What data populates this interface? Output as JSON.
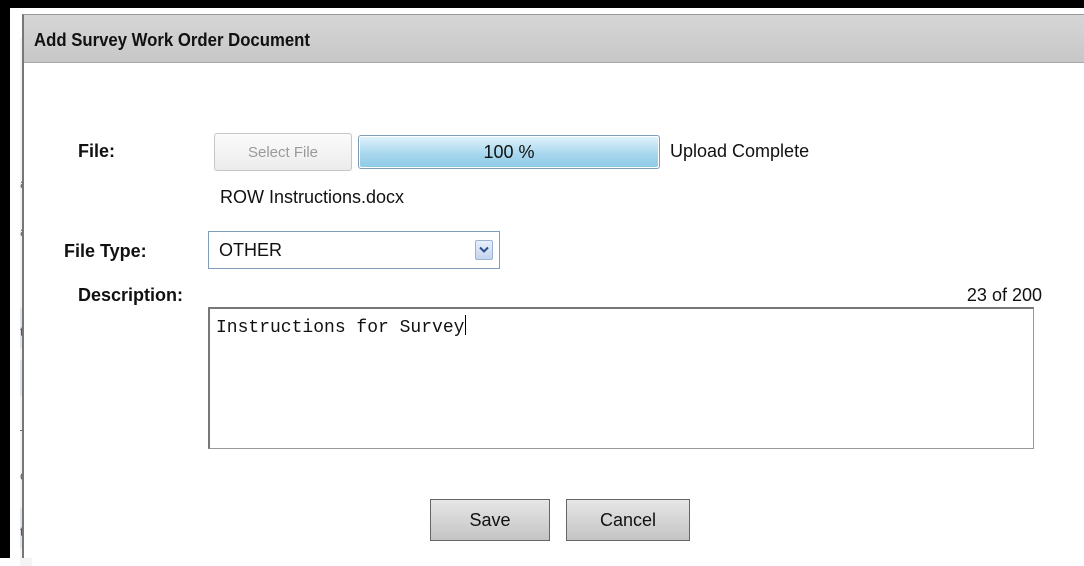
{
  "dialog": {
    "title": "Add Survey Work Order Document"
  },
  "file": {
    "label": "File:",
    "select_button": "Select File",
    "progress_text": "100 %",
    "progress_fraction": 1.0,
    "status": "Upload Complete",
    "file_name": "ROW Instructions.docx"
  },
  "file_type": {
    "label": "File Type:",
    "selected": "OTHER"
  },
  "description": {
    "label": "Description:",
    "counter": "23 of 200",
    "value": "Instructions for Survey"
  },
  "actions": {
    "save": "Save",
    "cancel": "Cancel"
  },
  "background_fragments": [
    "a",
    "a",
    "t",
    "c",
    "t"
  ],
  "colors": {
    "title_bar": "#cfcfcf",
    "progress_fill": "#a9d8ee",
    "dropdown_border": "#7f9db9"
  },
  "icons": {
    "dropdown": "chevron-down-icon"
  }
}
